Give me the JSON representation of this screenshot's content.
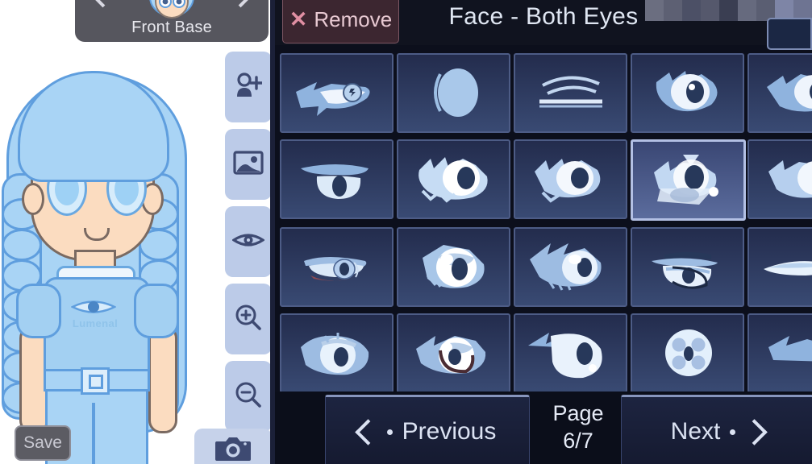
{
  "character_panel": {
    "base_selector": {
      "label": "Front Base",
      "prev_icon": "chevron-left-icon",
      "next_icon": "chevron-right-icon",
      "preview_icon": "character-head-icon"
    },
    "shirt_text": "Lumenal",
    "shirt_logo_icon": "eye-icon",
    "tools": [
      {
        "name": "add-character-button",
        "icon": "person-plus-icon"
      },
      {
        "name": "background-button",
        "icon": "image-icon"
      },
      {
        "name": "visibility-button",
        "icon": "eye-icon"
      },
      {
        "name": "zoom-in-button",
        "icon": "zoom-in-icon"
      },
      {
        "name": "zoom-out-button",
        "icon": "zoom-out-icon"
      }
    ],
    "camera_button": {
      "label": "",
      "icon": "camera-icon"
    },
    "save_button": {
      "label": "Save"
    }
  },
  "editor": {
    "remove_button": {
      "label": "Remove",
      "icon": "x-icon"
    },
    "title": "Face - Both Eyes",
    "censor_overlay": true,
    "grid": {
      "columns": 5,
      "rows": 4,
      "selected_index": 13,
      "items": [
        {
          "id": 1,
          "name": "eye-asset-sharp-lash"
        },
        {
          "id": 2,
          "name": "eye-asset-plain-oval"
        },
        {
          "id": 3,
          "name": "eye-asset-closed-lines"
        },
        {
          "id": 4,
          "name": "eye-asset-spiky-round"
        },
        {
          "id": 5,
          "name": "eye-asset-spiky-wide"
        },
        {
          "id": 6,
          "name": "eye-asset-flat-lid"
        },
        {
          "id": 7,
          "name": "eye-asset-jagged-large"
        },
        {
          "id": 8,
          "name": "eye-asset-jagged-soft"
        },
        {
          "id": 9,
          "name": "eye-asset-angular-selected"
        },
        {
          "id": 10,
          "name": "eye-asset-angular-right"
        },
        {
          "id": 11,
          "name": "eye-asset-narrow-liner"
        },
        {
          "id": 12,
          "name": "eye-asset-round-bright"
        },
        {
          "id": 13,
          "name": "eye-asset-swept-lash"
        },
        {
          "id": 14,
          "name": "eye-asset-half-lid"
        },
        {
          "id": 15,
          "name": "eye-asset-slim-crescent"
        },
        {
          "id": 16,
          "name": "eye-asset-lined-oval"
        },
        {
          "id": 17,
          "name": "eye-asset-curved-smile"
        },
        {
          "id": 18,
          "name": "eye-asset-tall-glossy"
        },
        {
          "id": 19,
          "name": "eye-asset-four-dot-circle"
        },
        {
          "id": 20,
          "name": "eye-asset-wing-partial"
        }
      ]
    },
    "footer": {
      "previous_label": "Previous",
      "next_label": "Next",
      "page_word": "Page",
      "page_value": "6/7"
    }
  },
  "colors": {
    "accent_selected": "#b3c0e4",
    "remove_bg": "#3c2630",
    "remove_text": "#e8c9d2",
    "editor_bg": "#0c0f1c",
    "cell_top": "#232c4d",
    "cell_bottom": "#394a73",
    "hair": "#a9d4f5",
    "skin": "#fbdcc0",
    "shirt": "#a3d0f2"
  }
}
